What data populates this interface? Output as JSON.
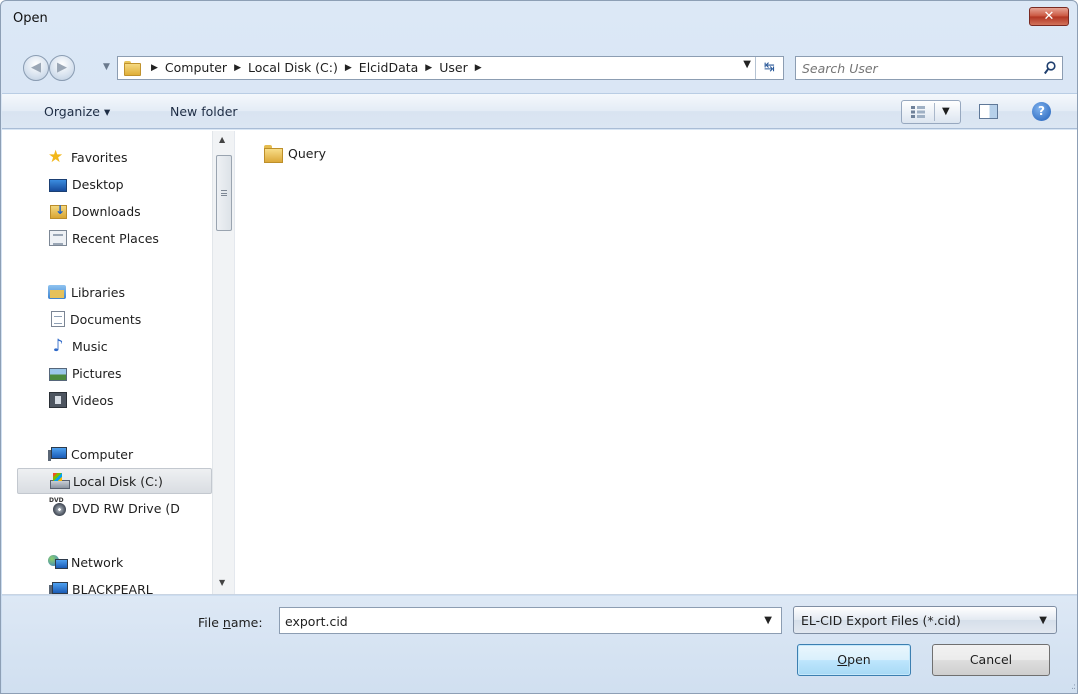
{
  "window": {
    "title": "Open",
    "close_glyph": "✕"
  },
  "nav": {
    "back_glyph": "◀",
    "forward_glyph": "▶",
    "breadcrumbs": [
      "Computer",
      "Local Disk (C:)",
      "ElcidData",
      "User"
    ],
    "separator": "▶",
    "refresh_glyph": "↹"
  },
  "search": {
    "placeholder": "Search User"
  },
  "toolbar": {
    "organize_label": "Organize ▾",
    "new_folder_label": "New folder",
    "help_glyph": "?"
  },
  "sidebar": {
    "favorites": {
      "label": "Favorites",
      "items": [
        "Desktop",
        "Downloads",
        "Recent Places"
      ]
    },
    "libraries": {
      "label": "Libraries",
      "items": [
        "Documents",
        "Music",
        "Pictures",
        "Videos"
      ]
    },
    "computer": {
      "label": "Computer",
      "items": [
        "Local Disk (C:)",
        "DVD RW Drive (D"
      ],
      "selected": "Local Disk (C:)"
    },
    "network": {
      "label": "Network",
      "items": [
        "BLACKPEARL"
      ]
    }
  },
  "files": [
    {
      "name": "Query",
      "type": "folder"
    }
  ],
  "footer": {
    "file_name_label_pre": "File ",
    "file_name_label_accel": "n",
    "file_name_label_post": "ame:",
    "file_name_value": "export.cid",
    "filter_value": "EL-CID Export Files (*.cid)",
    "open_accel": "O",
    "open_rest": "pen",
    "cancel_label": "Cancel"
  },
  "colors": {
    "accent": "#3c7fb1",
    "close_red": "#c9533c",
    "folder": "#e7c45a"
  }
}
